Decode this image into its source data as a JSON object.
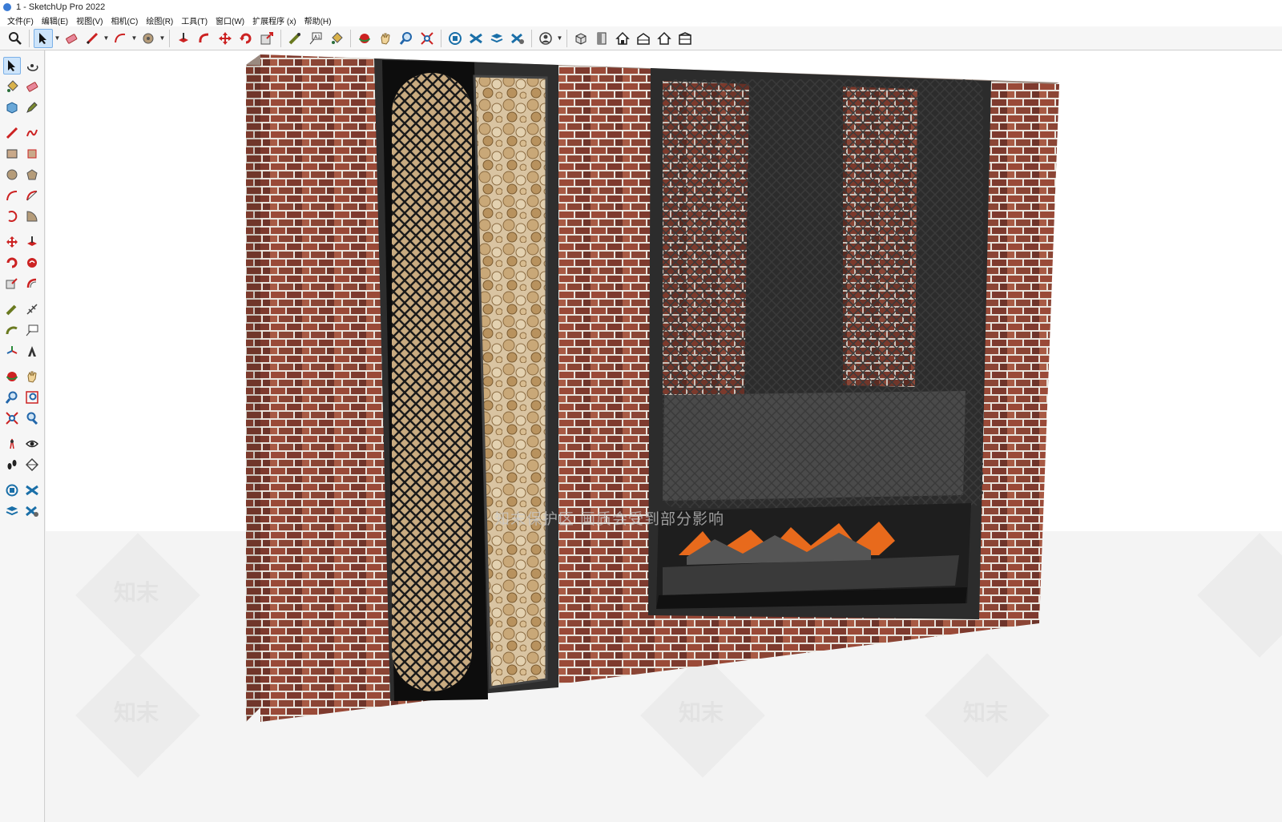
{
  "window": {
    "title": "1 - SketchUp Pro 2022"
  },
  "menu": [
    {
      "label": "文件(F)"
    },
    {
      "label": "编辑(E)"
    },
    {
      "label": "视图(V)"
    },
    {
      "label": "相机(C)"
    },
    {
      "label": "绘图(R)"
    },
    {
      "label": "工具(T)"
    },
    {
      "label": "窗口(W)"
    },
    {
      "label": "扩展程序 (x)"
    },
    {
      "label": "帮助(H)"
    }
  ],
  "toolbar": {
    "items": [
      "search-icon",
      "select-icon",
      "eraser-icon",
      "pencil-icon",
      "arc-icon",
      "circle-icon",
      "pushpull-icon",
      "followme-icon",
      "move-icon",
      "rotate-icon",
      "scale-icon",
      "tape-icon",
      "text-icon",
      "paint-icon",
      "orbit-icon",
      "pan-icon",
      "zoom-icon",
      "zoom-extents-icon",
      "warehouse-icon",
      "extension-warehouse-icon",
      "layout-icon",
      "extension-manager-icon",
      "profile-icon",
      "iso-view-icon",
      "top-view-icon",
      "front-view-icon",
      "right-view-icon",
      "back-view-icon",
      "left-view-icon"
    ]
  },
  "lefttools": {
    "items": [
      "select-icon",
      "orbit-icon",
      "paint-icon",
      "eraser-icon",
      "component-icon",
      "tag-icon",
      "line-icon",
      "freehand-icon",
      "rectangle-icon",
      "rotated-rect-icon",
      "circle-icon",
      "polygon-icon",
      "arc-icon",
      "arc2-icon",
      "pie-icon",
      "arc3-icon",
      "move-icon",
      "pushpull-icon",
      "rotate-icon",
      "followme-icon",
      "scale-icon",
      "offset-icon",
      "tape-icon",
      "dimension-icon",
      "protractor-icon",
      "text-icon",
      "axes-icon",
      "3dtext-icon",
      "orbit2-icon",
      "pan-icon",
      "zoom-icon",
      "zoom-window-icon",
      "zoom-extents-icon",
      "previous-view-icon",
      "position-camera-icon",
      "lookaround-icon",
      "walk-icon",
      "section-plane-icon",
      "warehouse-icon",
      "extension-warehouse-icon",
      "layout-icon",
      "extension-manager-icon"
    ]
  },
  "viewport": {
    "watermark": "知末",
    "notice": "知末保护区  画质会受到部分影响"
  }
}
